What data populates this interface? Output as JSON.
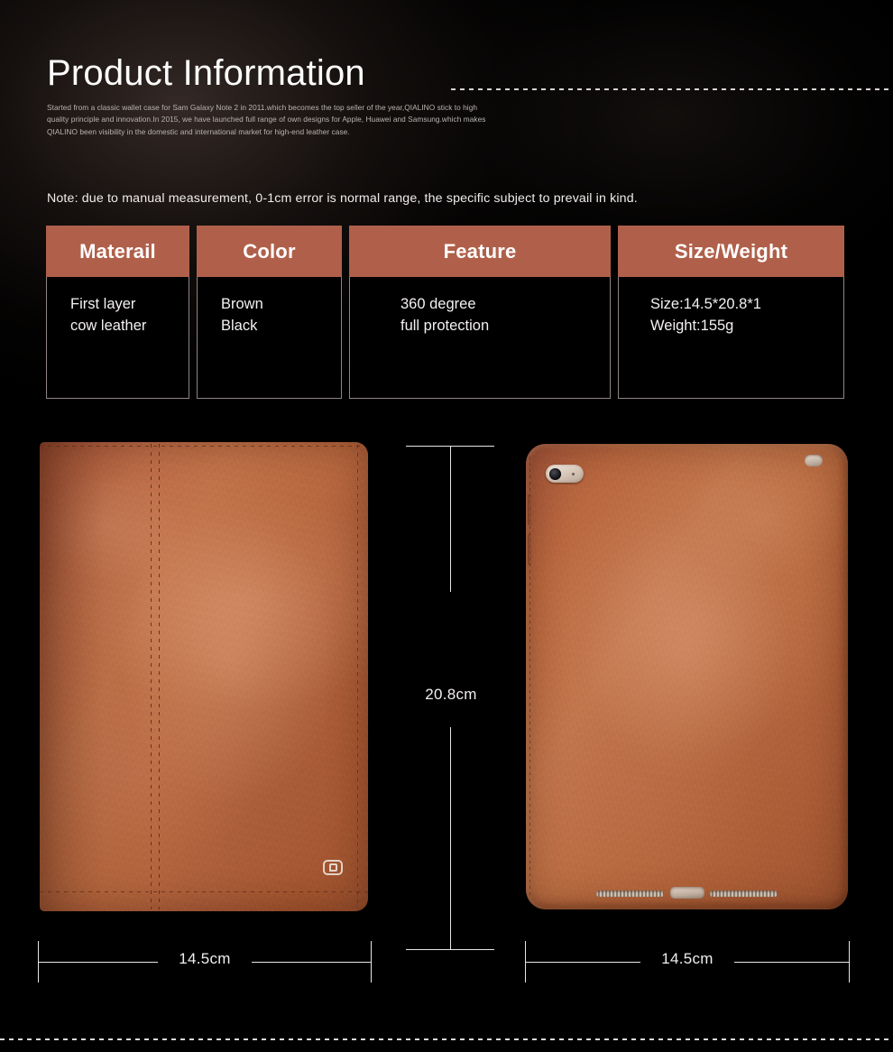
{
  "header": {
    "title": "Product Information",
    "intro": "Started from a classic wallet case for Sam Galaxy Note 2 in 2011.which becomes the top seller of the year,QIALINO stick to high quality principle and innovation.In 2015, we have launched full range of own designs for Apple, Huawei and Samsung.which makes QIALINO been visibility in the domestic and international market for high-end leather case."
  },
  "note": "Note: due to manual measurement, 0-1cm error is normal range, the specific subject to prevail in kind.",
  "spec_table": {
    "headers": [
      "Materail",
      "Color",
      "Feature",
      "Size/Weight"
    ],
    "values": [
      "First layer\ncow leather",
      "Brown\nBlack",
      "360 degree\nfull protection",
      "Size:14.5*20.8*1\nWeight:155g"
    ]
  },
  "dimensions": {
    "height_label": "20.8cm",
    "width_left_label": "14.5cm",
    "width_right_label": "14.5cm"
  },
  "product": {
    "brand_logo": "qialino-logo",
    "front_alt": "brown-leather-folio-front",
    "back_alt": "brown-leather-tablet-back"
  },
  "colors": {
    "accent": "#b0604a",
    "background": "#000000",
    "text": "#f2efed",
    "leather": "#b86a3f",
    "rule": "#e9e6e4"
  }
}
